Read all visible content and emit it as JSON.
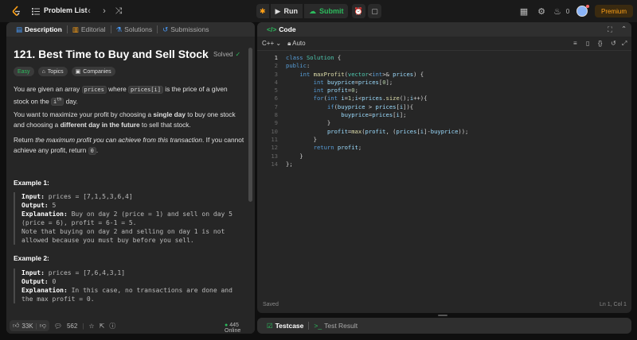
{
  "topbar": {
    "title": "Problem List",
    "run_label": "Run",
    "submit_label": "Submit",
    "streak": "0",
    "premium_label": "Premium"
  },
  "left_tabs": [
    "Description",
    "Editorial",
    "Solutions",
    "Submissions"
  ],
  "problem": {
    "title": "121. Best Time to Buy and Sell Stock",
    "status": "Solved",
    "tags": [
      "Easy",
      "Topics",
      "Companies"
    ],
    "p1_a": "You are given an array ",
    "p1_code1": "prices",
    "p1_b": " where ",
    "p1_code2": "prices[i]",
    "p1_c": " is the price of a given stock on the ",
    "p1_code3": "i",
    "p1_sup": "th",
    "p1_d": " day.",
    "p2_a": "You want to maximize your profit by choosing a ",
    "p2_b1": "single day",
    "p2_b": " to buy one stock and choosing a ",
    "p2_b2": "different day in the future",
    "p2_c": " to sell that stock.",
    "p3_a": "Return ",
    "p3_i": "the maximum profit you can achieve from this transaction",
    "p3_b": ". If you cannot achieve any profit, return ",
    "p3_code": "0",
    "p3_c": "."
  },
  "examples": [
    {
      "heading": "Example 1:",
      "input_label": "Input:",
      "input": " prices = [7,1,5,3,6,4]",
      "output_label": "Output:",
      "output": " 5",
      "expl_label": "Explanation:",
      "expl_l1": " Buy on day 2 (price = 1) and sell on day 5",
      "expl_l2": "(price = 6), profit = 6-1 = 5.",
      "expl_l3": "Note that buying on day 2 and selling on day 1 is not",
      "expl_l4": "allowed because you must buy before you sell."
    },
    {
      "heading": "Example 2:",
      "input_label": "Input:",
      "input": " prices = [7,6,4,3,1]",
      "output_label": "Output:",
      "output": " 0",
      "expl_label": "Explanation:",
      "expl_l1": " In this case, no transactions are done and",
      "expl_l2": "the max profit = 0."
    }
  ],
  "footer": {
    "likes": "33K",
    "comments": "562",
    "online": "445 Online"
  },
  "code_panel": {
    "title": "Code",
    "language": "C++",
    "mode": "Auto",
    "status": "Saved",
    "cursor": "Ln 1, Col 1"
  },
  "code_lines": [
    "class Solution {",
    "public:",
    "    int maxProfit(vector<int>& prices) {",
    "        int buyprice=prices[0];",
    "        int profit=0;",
    "        for(int i=1;i<prices.size();i++){",
    "            if(buyprice > prices[i]){",
    "                buyprice=prices[i];",
    "            }",
    "            profit=max(profit, (prices[i]-buyprice));",
    "        }",
    "        return profit;",
    "    }",
    "};"
  ],
  "bottom_tabs": [
    "Testcase",
    "Test Result"
  ],
  "colors": {
    "accent": "#ffa116",
    "success": "#2cbb5d",
    "panel": "#262626",
    "background": "#0f0f0f"
  }
}
